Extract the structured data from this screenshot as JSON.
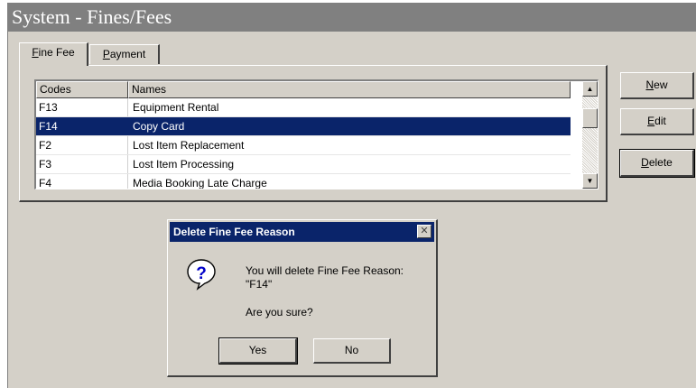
{
  "window": {
    "title": "System - Fines/Fees"
  },
  "tabs": [
    {
      "label": "Fine Fee",
      "mnemonic": "F",
      "rest": "ine Fee"
    },
    {
      "label": "Payment",
      "mnemonic": "P",
      "rest": "ayment"
    }
  ],
  "list": {
    "columns": [
      "Codes",
      "Names"
    ],
    "rows": [
      {
        "code": "F13",
        "name": "Equipment Rental",
        "selected": false
      },
      {
        "code": "F14",
        "name": "Copy Card",
        "selected": true
      },
      {
        "code": "F2",
        "name": "Lost Item Replacement",
        "selected": false
      },
      {
        "code": "F3",
        "name": "Lost Item Processing",
        "selected": false
      },
      {
        "code": "F4",
        "name": "Media Booking Late Charge",
        "selected": false
      }
    ]
  },
  "buttons": {
    "new": {
      "mnemonic": "N",
      "rest": "ew"
    },
    "edit": {
      "mnemonic": "E",
      "rest": "dit"
    },
    "delete": {
      "mnemonic": "D",
      "rest": "elete"
    }
  },
  "dialog": {
    "title": "Delete Fine Fee Reason",
    "close": "✕",
    "message_line1": "You will delete Fine Fee Reason:",
    "message_line2": "\"F14\"",
    "question": "Are you sure?",
    "yes_label": "Yes",
    "no_label": "No",
    "icon": "question-icon"
  },
  "colors": {
    "selection": "#0a246a",
    "dialog_title": "#0a246a",
    "window_title": "#808080",
    "face": "#d4d0c8"
  }
}
